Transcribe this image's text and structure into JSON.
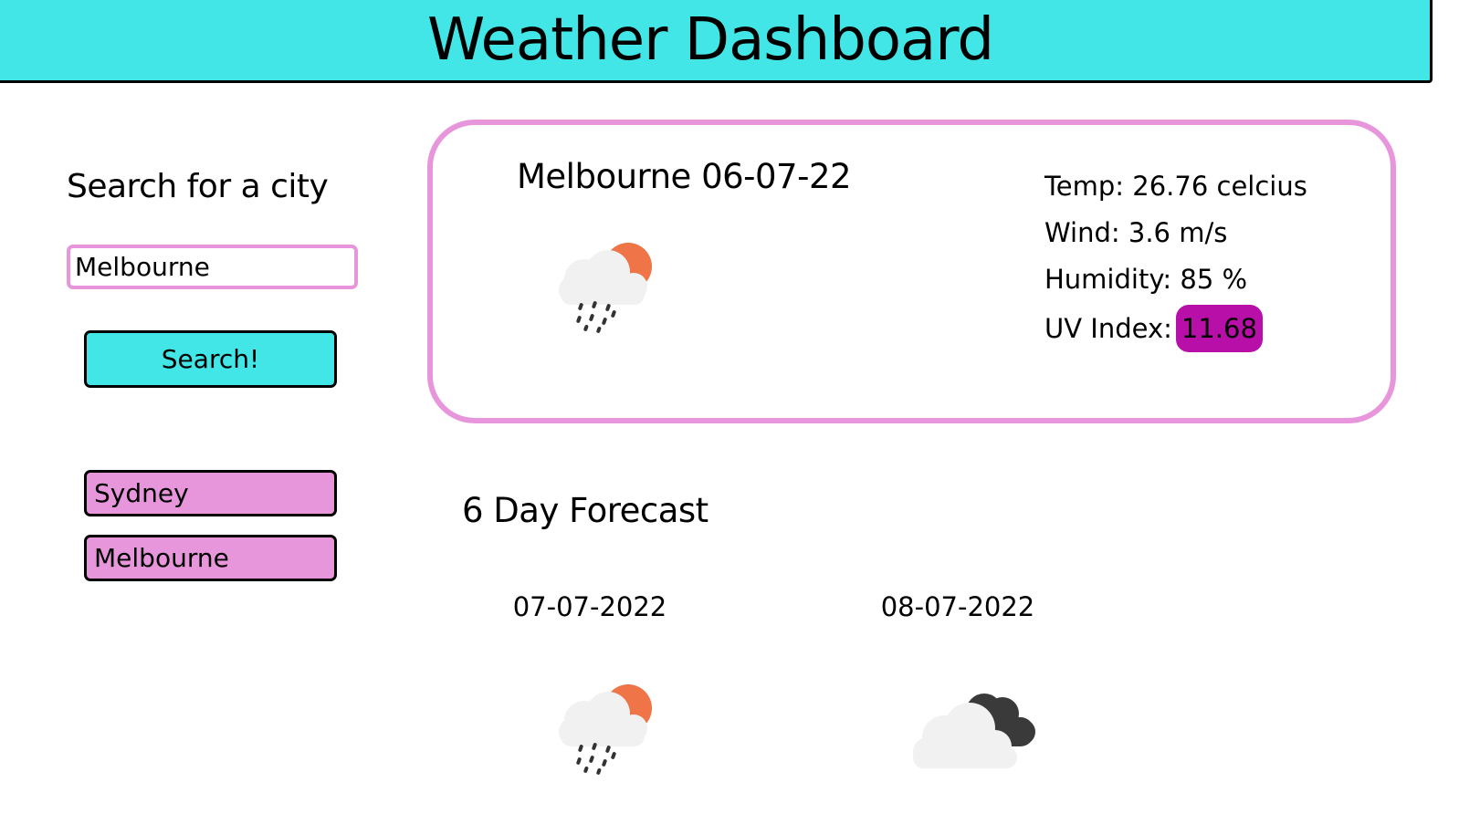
{
  "header": {
    "title": "Weather Dashboard"
  },
  "sidebar": {
    "title": "Search for a city",
    "search_value": "Melbourne",
    "search_button_label": "Search!",
    "history": [
      {
        "label": "Sydney"
      },
      {
        "label": "Melbourne"
      }
    ]
  },
  "current": {
    "title": "Melbourne 06-07-22",
    "icon": "light-rain-partly-cloudy-icon",
    "temp": "Temp: 26.76 celcius",
    "wind": "Wind: 3.6 m/s",
    "humidity": "Humidity: 85 %",
    "uv_label": "UV Index:",
    "uv_value": "11.68"
  },
  "forecast": {
    "title": "6 Day Forecast",
    "days": [
      {
        "date": "07-07-2022",
        "icon": "light-rain-partly-cloudy-icon"
      },
      {
        "date": "08-07-2022",
        "icon": "overcast-clouds-icon"
      }
    ]
  },
  "colors": {
    "accent_cyan": "#42e6e6",
    "accent_pink": "#e896dc",
    "uv_high": "#b80fa8"
  }
}
